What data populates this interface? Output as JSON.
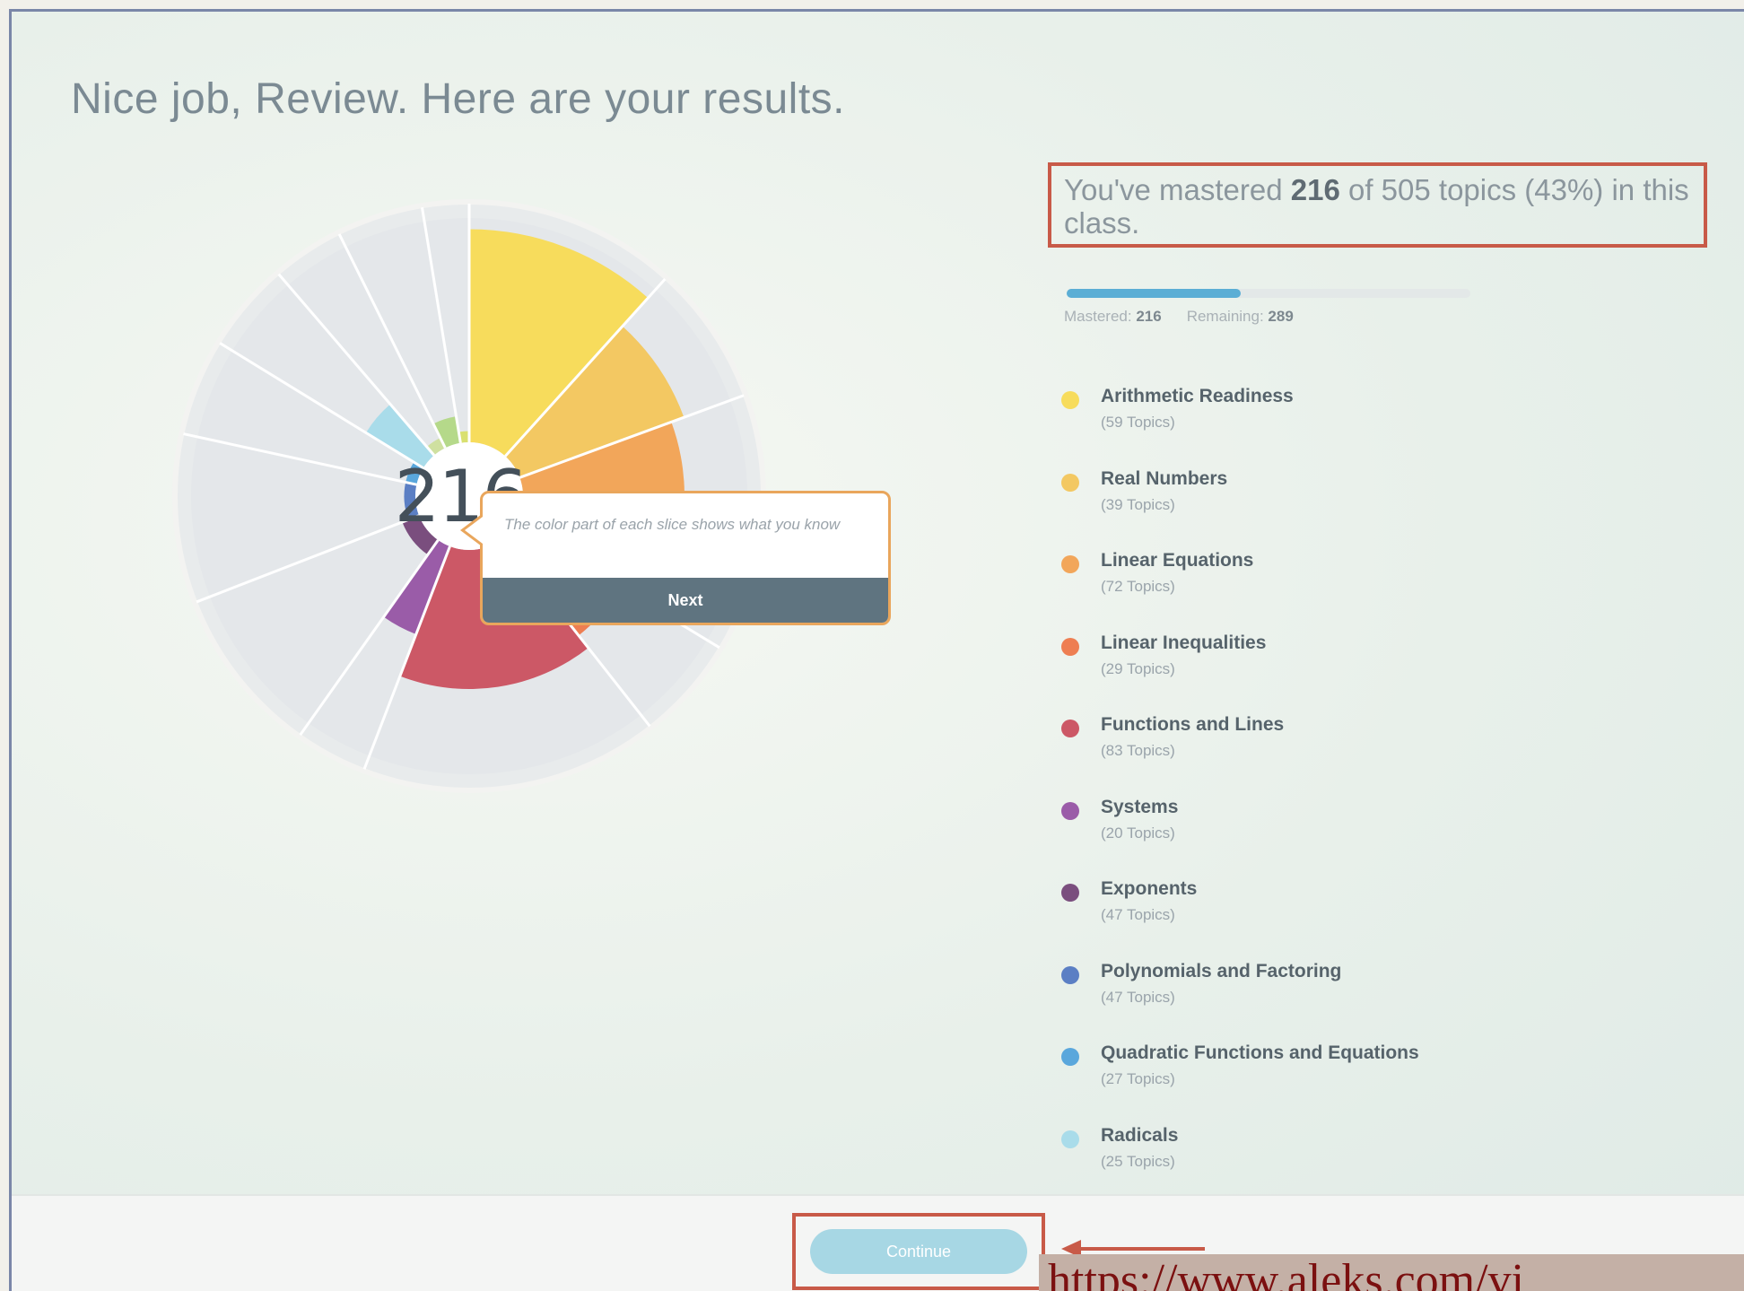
{
  "header": {
    "title": "Nice job, Review. Here are your results."
  },
  "wheel": {
    "center_count": "216"
  },
  "tooltip": {
    "text": "The color part of each slice shows what you know",
    "button_label": "Next"
  },
  "summary": {
    "prefix": "You've mastered ",
    "mastered": "216",
    "suffix": " of 505 topics (43%) in this class."
  },
  "progress": {
    "fraction": 0.43,
    "mastered_label": "Mastered",
    "mastered_value": "216",
    "remaining_label": "Remaining",
    "remaining_value": "289"
  },
  "legend": [
    {
      "name": "Arithmetic Readiness",
      "count": "(59 Topics)",
      "color": "#f7dc5c"
    },
    {
      "name": "Real Numbers",
      "count": "(39 Topics)",
      "color": "#f3c862"
    },
    {
      "name": "Linear Equations",
      "count": "(72 Topics)",
      "color": "#f2a65a"
    },
    {
      "name": "Linear Inequalities",
      "count": "(29 Topics)",
      "color": "#ee7e52"
    },
    {
      "name": "Functions and Lines",
      "count": "(83 Topics)",
      "color": "#cc5866"
    },
    {
      "name": "Systems",
      "count": "(20 Topics)",
      "color": "#9a5ca8"
    },
    {
      "name": "Exponents",
      "count": "(47 Topics)",
      "color": "#7a4e7e"
    },
    {
      "name": "Polynomials and Factoring",
      "count": "(47 Topics)",
      "color": "#5b7fc4"
    },
    {
      "name": "Quadratic Functions and Equations",
      "count": "(27 Topics)",
      "color": "#5aa7dc"
    },
    {
      "name": "Radicals",
      "count": "(25 Topics)",
      "color": "#a9dcea"
    }
  ],
  "footer": {
    "continue_label": "Continue"
  },
  "overlay": {
    "url_text": "https://www.aleks.com/vi"
  }
}
